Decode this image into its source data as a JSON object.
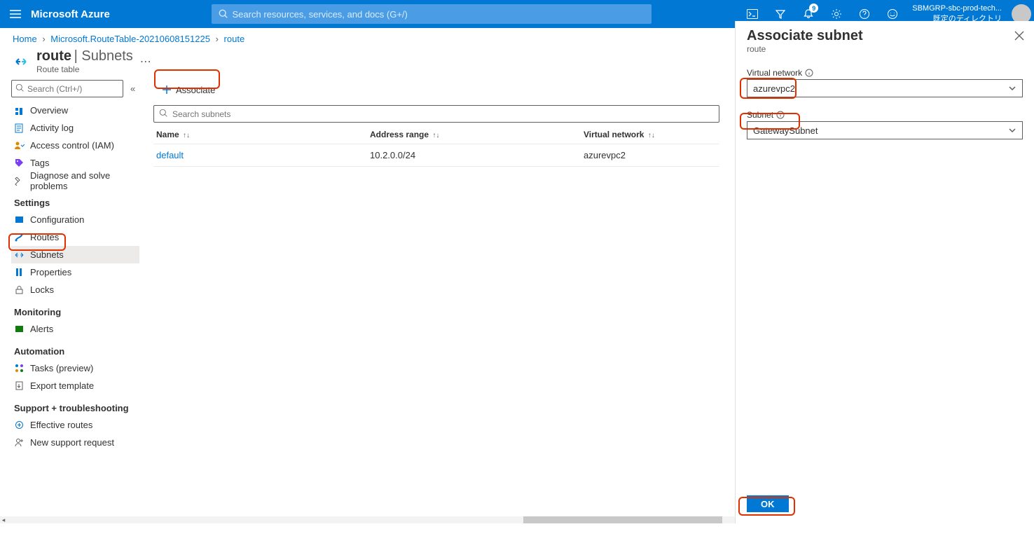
{
  "top": {
    "brand": "Microsoft Azure",
    "search_placeholder": "Search resources, services, and docs (G+/)",
    "notif_count": "9",
    "account_name": "SBMGRP-sbc-prod-tech...",
    "account_dir": "既定のディレクトリ"
  },
  "breadcrumb": {
    "home": "Home",
    "rt": "Microsoft.RouteTable-20210608151225",
    "res": "route"
  },
  "header": {
    "title": "route",
    "section": "Subnets",
    "type": "Route table"
  },
  "sidebar": {
    "search_ph": "Search (Ctrl+/)",
    "items_top": [
      "Overview",
      "Activity log",
      "Access control (IAM)",
      "Tags",
      "Diagnose and solve problems"
    ],
    "settings_h": "Settings",
    "settings": [
      "Configuration",
      "Routes",
      "Subnets",
      "Properties",
      "Locks"
    ],
    "monitoring_h": "Monitoring",
    "monitoring": [
      "Alerts"
    ],
    "automation_h": "Automation",
    "automation": [
      "Tasks (preview)",
      "Export template"
    ],
    "support_h": "Support + troubleshooting",
    "support": [
      "Effective routes",
      "New support request"
    ]
  },
  "main": {
    "associate": "Associate",
    "subsearch_ph": "Search subnets",
    "cols": {
      "name": "Name",
      "addr": "Address range",
      "vnet": "Virtual network"
    },
    "rows": [
      {
        "name": "default",
        "addr": "10.2.0.0/24",
        "vnet": "azurevpc2"
      }
    ]
  },
  "panel": {
    "title": "Associate subnet",
    "sub": "route",
    "vn_label": "Virtual network",
    "vn_value": "azurevpc2",
    "sn_label": "Subnet",
    "sn_value": "GatewaySubnet",
    "ok": "OK"
  }
}
